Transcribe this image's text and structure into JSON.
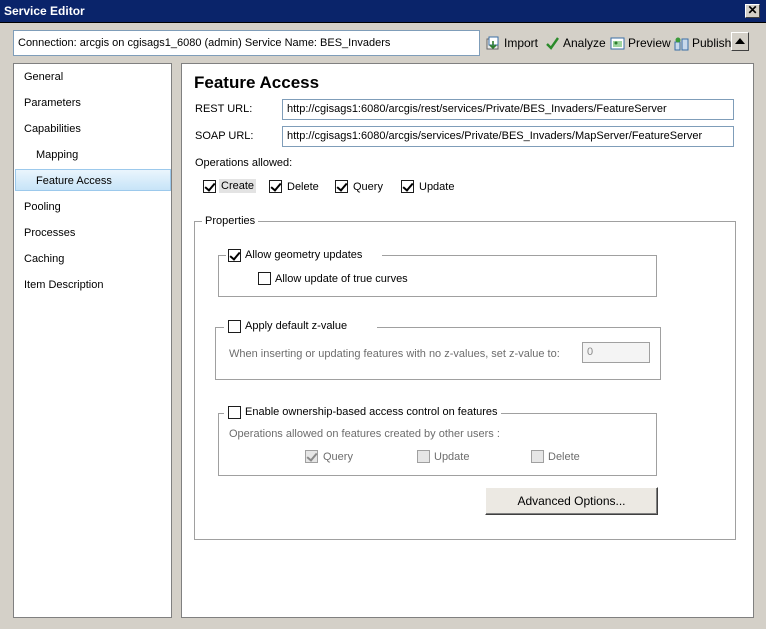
{
  "window": {
    "title": "Service Editor",
    "close_glyph": "✕"
  },
  "header": {
    "connection_text": "Connection: arcgis on cgisags1_6080 (admin)   Service Name: BES_Invaders",
    "toolbar": [
      {
        "label": "Import",
        "icon": "import-icon"
      },
      {
        "label": "Analyze",
        "icon": "checkmark-icon"
      },
      {
        "label": "Preview",
        "icon": "preview-icon"
      },
      {
        "label": "Publish",
        "icon": "publish-icon"
      }
    ]
  },
  "sidebar": {
    "items": [
      {
        "label": "General"
      },
      {
        "label": "Parameters"
      },
      {
        "label": "Capabilities"
      },
      {
        "label": "Mapping"
      },
      {
        "label": "Feature Access"
      },
      {
        "label": "Pooling"
      },
      {
        "label": "Processes"
      },
      {
        "label": "Caching"
      },
      {
        "label": "Item Description"
      }
    ],
    "selected": "Feature Access"
  },
  "main": {
    "title": "Feature Access",
    "rest_label": "REST URL:",
    "rest_url": "http://cgisags1:6080/arcgis/rest/services/Private/BES_Invaders/FeatureServer",
    "soap_label": "SOAP URL:",
    "soap_url": "http://cgisags1:6080/arcgis/services/Private/BES_Invaders/MapServer/FeatureServer",
    "operations_label": "Operations allowed:",
    "operations": [
      {
        "label": "Create",
        "checked": true
      },
      {
        "label": "Delete",
        "checked": true
      },
      {
        "label": "Query",
        "checked": true
      },
      {
        "label": "Update",
        "checked": true
      }
    ],
    "properties": {
      "label": "Properties",
      "geometry": {
        "label": "Allow geometry updates",
        "checked": true,
        "true_curves_label": "Allow update of true curves",
        "true_curves_checked": false
      },
      "zvalue": {
        "label": "Apply default z-value",
        "checked": false,
        "desc": "When inserting or updating features with no z-values, set z-value to:",
        "value": "0"
      },
      "ownership": {
        "label": "Enable ownership-based access control on features",
        "checked": false,
        "desc": "Operations allowed on features created by other users :",
        "ops": [
          {
            "label": "Query",
            "checked": true
          },
          {
            "label": "Update",
            "checked": false
          },
          {
            "label": "Delete",
            "checked": false
          }
        ]
      },
      "advanced_button": "Advanced Options..."
    }
  }
}
